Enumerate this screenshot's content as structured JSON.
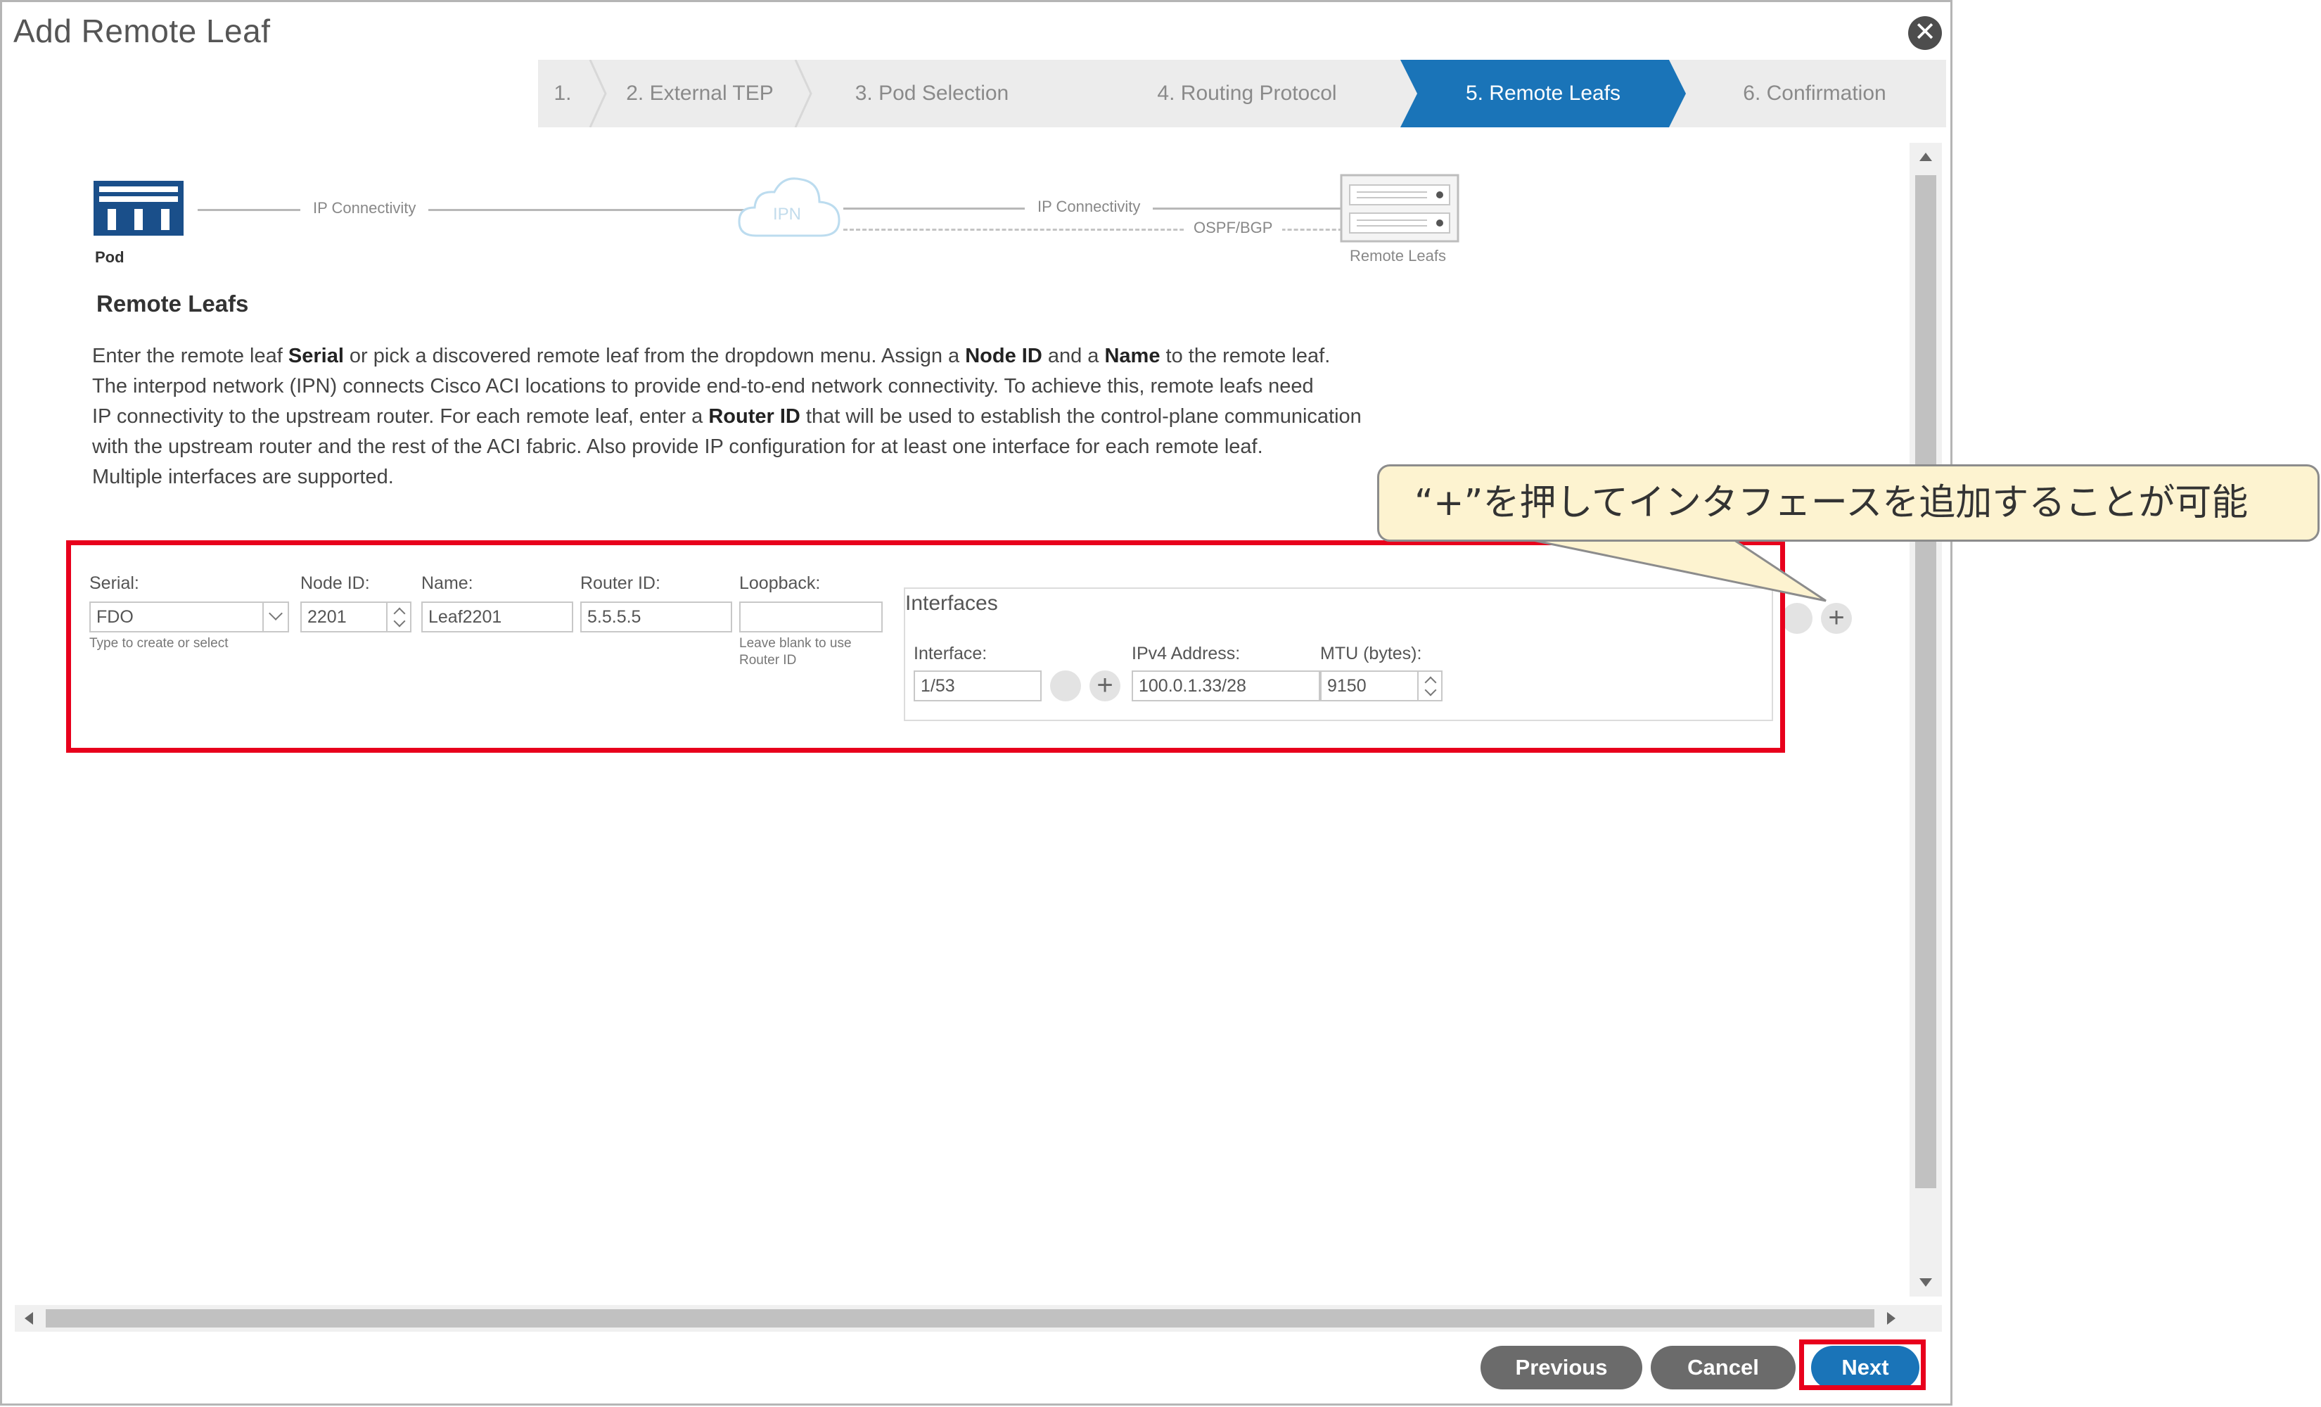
{
  "dialog": {
    "title": "Add Remote Leaf"
  },
  "wizard": {
    "steps": [
      "1.",
      "2. External TEP",
      "3. Pod Selection",
      "4. Routing Protocol",
      "5. Remote Leafs",
      "6. Confirmation"
    ],
    "active_index": 4
  },
  "diagram": {
    "pod_label": "Pod",
    "ip_connectivity_1": "IP Connectivity",
    "ipn_label": "IPN",
    "ip_connectivity_2": "IP Connectivity",
    "ospf_bgp": "OSPF/BGP",
    "remote_leafs_label": "Remote Leafs"
  },
  "section": {
    "title": "Remote Leafs",
    "desc": {
      "l1_a": "Enter the remote leaf ",
      "l1_b": "Serial",
      "l1_c": " or pick a discovered remote leaf from the dropdown menu. Assign a ",
      "l1_d": "Node ID",
      "l1_e": " and a ",
      "l1_f": "Name",
      "l1_g": " to the remote leaf.",
      "l2": "The interpod network (IPN) connects Cisco ACI locations to provide end-to-end network connectivity. To achieve this, remote leafs need",
      "l3_a": "IP connectivity to the upstream router. For each remote leaf, enter a ",
      "l3_b": "Router ID",
      "l3_c": " that will be used to establish the control-plane communication",
      "l4": "with the upstream router and the rest of the ACI fabric. Also provide IP configuration for at least one interface for each remote leaf.",
      "l5": "Multiple interfaces are supported."
    }
  },
  "form": {
    "serial_label": "Serial:",
    "serial_value": "FDO",
    "serial_hint": "Type to create or select",
    "node_id_label": "Node ID:",
    "node_id_value": "2201",
    "name_label": "Name:",
    "name_value": "Leaf2201",
    "router_id_label": "Router ID:",
    "router_id_value": "5.5.5.5",
    "loopback_label": "Loopback:",
    "loopback_value": "",
    "loopback_hint_1": "Leave blank to use",
    "loopback_hint_2": "Router ID",
    "interfaces_title": "Interfaces",
    "interface_label": "Interface:",
    "interface_value": "1/53",
    "ipv4_label": "IPv4 Address:",
    "ipv4_value": "100.0.1.33/28",
    "mtu_label": "MTU (bytes):",
    "mtu_value": "9150"
  },
  "callout": {
    "text": "“+”を押してインタフェースを追加することが可能"
  },
  "footer": {
    "previous": "Previous",
    "cancel": "Cancel",
    "next": "Next"
  },
  "colors": {
    "accent": "#1a74b8",
    "highlight": "#e8001c",
    "callout_bg": "#fdf3d0",
    "button": "#6b6b6b"
  }
}
